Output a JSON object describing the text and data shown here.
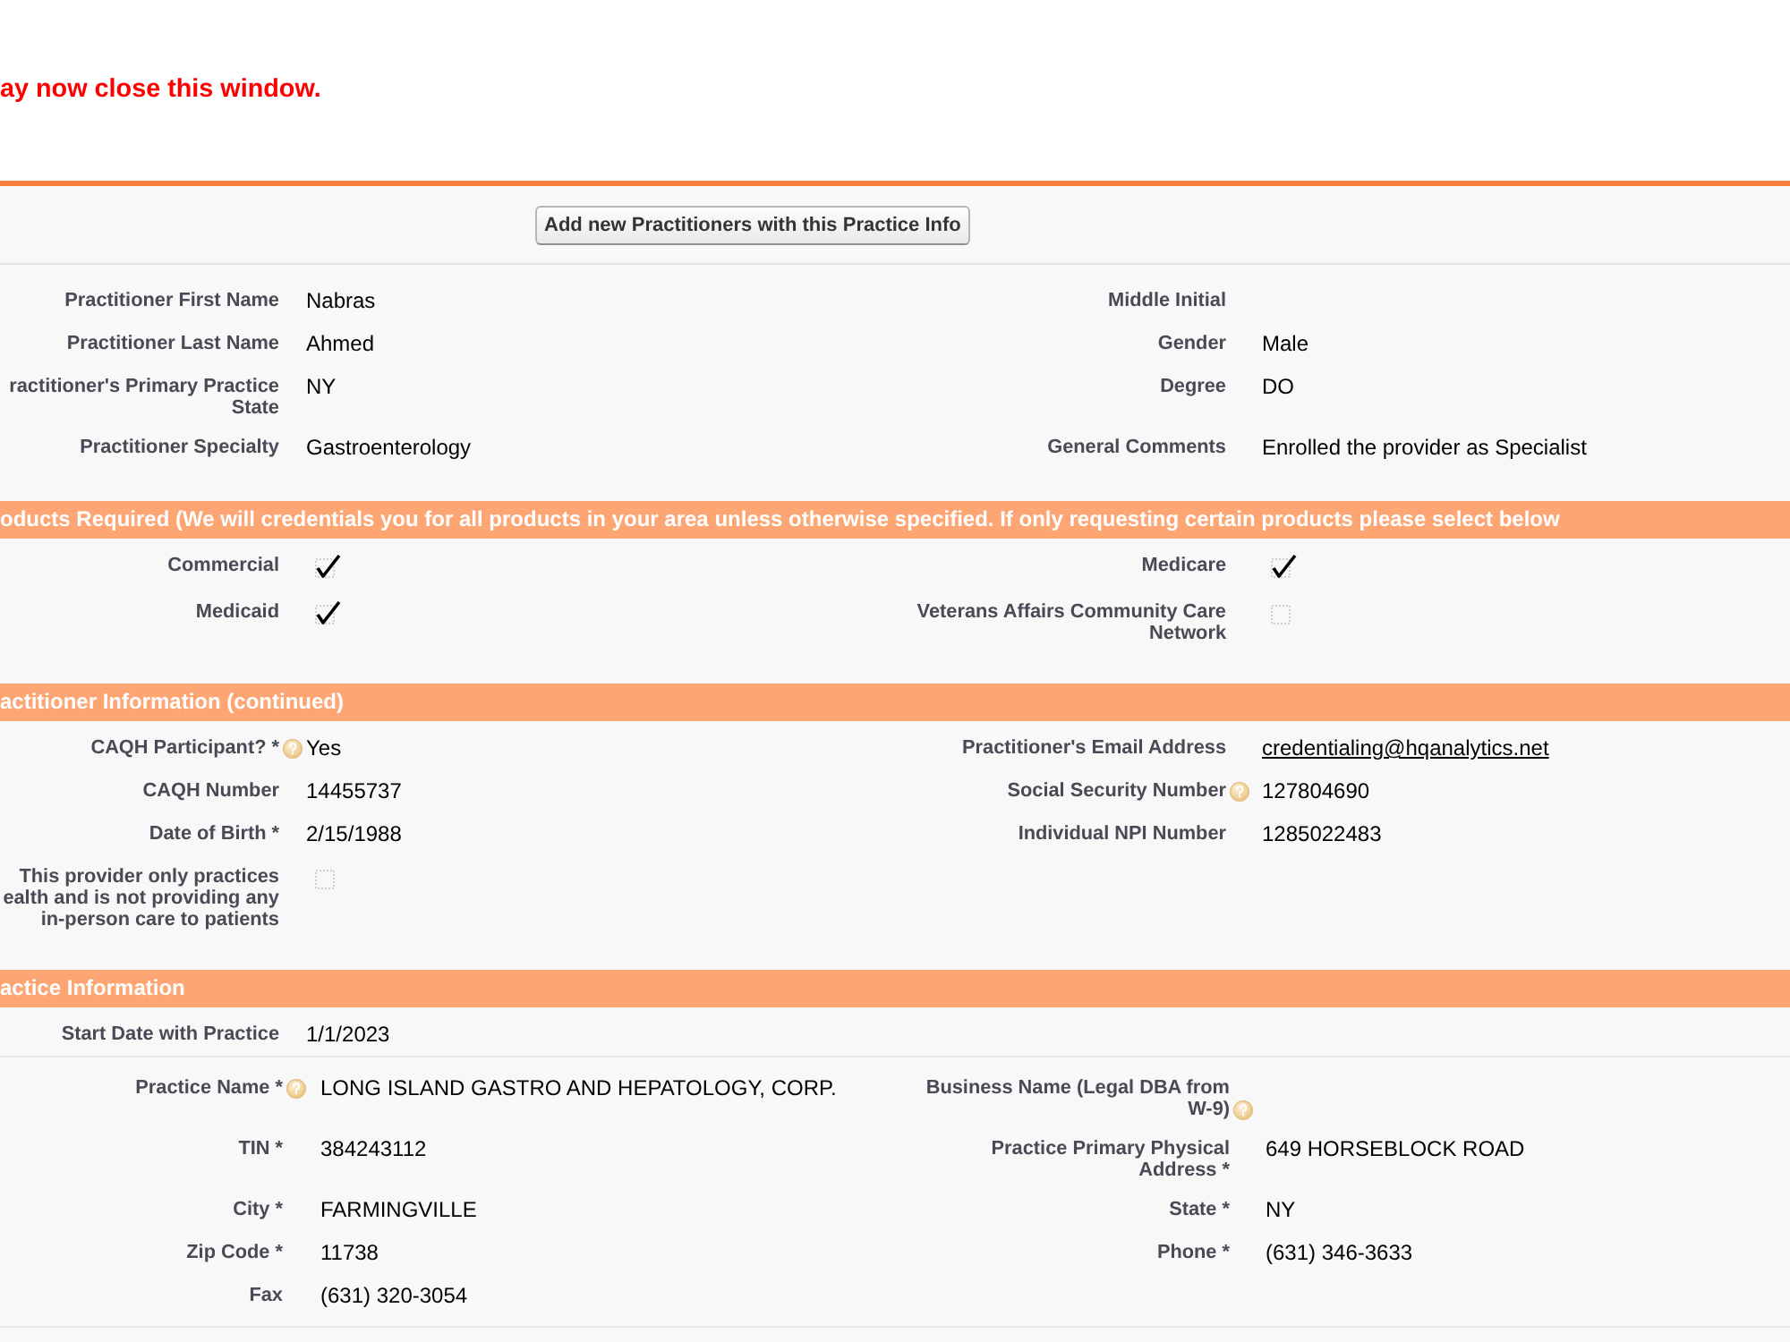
{
  "message": "ay now close this window.",
  "toolbar": {
    "button": "Add new Practitioners with this Practice Info"
  },
  "sections": [
    {
      "rows": [
        {
          "left": {
            "label": "Practitioner First Name",
            "kind": "text",
            "value": "Nabras"
          },
          "right": {
            "label": "Middle Initial",
            "kind": "text"
          }
        },
        {
          "left": {
            "label": "Practitioner Last Name",
            "kind": "text",
            "value": "Ahmed"
          },
          "right": {
            "label": "Gender",
            "kind": "text",
            "value": "Male"
          }
        },
        {
          "left": {
            "label": "ractitioner's Primary Practice\nState",
            "kind": "text",
            "value": "NY"
          },
          "right": {
            "label": "Degree",
            "kind": "text",
            "value": "DO"
          }
        },
        {
          "left": {
            "label": "Practitioner Specialty",
            "kind": "text",
            "value": "Gastroenterology"
          },
          "right": {
            "label": "General Comments",
            "kind": "text",
            "value": "Enrolled the provider as Specialist"
          }
        }
      ]
    },
    {
      "header": "oducts Required (We will credentials you for all products in your area unless otherwise specified. If only requesting certain products please select below",
      "rows": [
        {
          "left": {
            "label": "Commercial",
            "kind": "checkbox",
            "checked": true
          },
          "right": {
            "label": "Medicare",
            "kind": "checkbox",
            "checked": true
          }
        },
        {
          "left": {
            "label": "Medicaid",
            "kind": "checkbox",
            "checked": true
          },
          "right": {
            "label": "Veterans Affairs Community Care\nNetwork",
            "kind": "checkbox",
            "checked": false
          }
        }
      ]
    },
    {
      "header": "actitioner Information (continued)",
      "rows": [
        {
          "left": {
            "label": "CAQH Participant? *",
            "help": true,
            "kind": "text",
            "value": "Yes"
          },
          "right": {
            "label": "Practitioner's Email Address",
            "kind": "link",
            "value": "credentialing@hqanalytics.net"
          }
        },
        {
          "left": {
            "label": "CAQH Number",
            "kind": "text",
            "value": "14455737"
          },
          "right": {
            "label": "Social Security Number",
            "help": true,
            "kind": "text",
            "value": "127804690"
          }
        },
        {
          "left": {
            "label": "Date of Birth *",
            "kind": "text",
            "value": "2/15/1988"
          },
          "right": {
            "label": "Individual NPI Number",
            "kind": "text",
            "value": "1285022483"
          }
        },
        {
          "left": {
            "label": "This provider only practices\nealth and is not providing any\nin-person care to patients",
            "kind": "checkbox",
            "checked": false
          }
        }
      ]
    },
    {
      "header": "actice Information",
      "rows": [
        {
          "left": {
            "label": "Start Date with Practice",
            "kind": "text",
            "value": "1/1/2023"
          }
        }
      ],
      "nested_rows": [
        {
          "left": {
            "label": "Practice Name *",
            "help": true,
            "kind": "text",
            "value": "LONG ISLAND GASTRO AND HEPATOLOGY, CORP."
          },
          "right": {
            "label": "Business Name (Legal DBA from\nW-9)",
            "help": true,
            "kind": "text"
          }
        },
        {
          "left": {
            "label": "TIN *",
            "kind": "text",
            "value": "384243112"
          },
          "right": {
            "label": "Practice Primary Physical\nAddress *",
            "kind": "text",
            "value": "649 HORSEBLOCK ROAD"
          }
        },
        {
          "left": {
            "label": "City *",
            "kind": "text",
            "value": "FARMINGVILLE"
          },
          "right": {
            "label": "State *",
            "kind": "text",
            "value": "NY"
          }
        },
        {
          "left": {
            "label": "Zip Code *",
            "kind": "text",
            "value": "11738"
          },
          "right": {
            "label": "Phone *",
            "kind": "text",
            "value": "(631) 346-3633"
          }
        },
        {
          "left": {
            "label": "Fax",
            "kind": "text",
            "value": "(631) 320-3054"
          }
        }
      ]
    }
  ]
}
